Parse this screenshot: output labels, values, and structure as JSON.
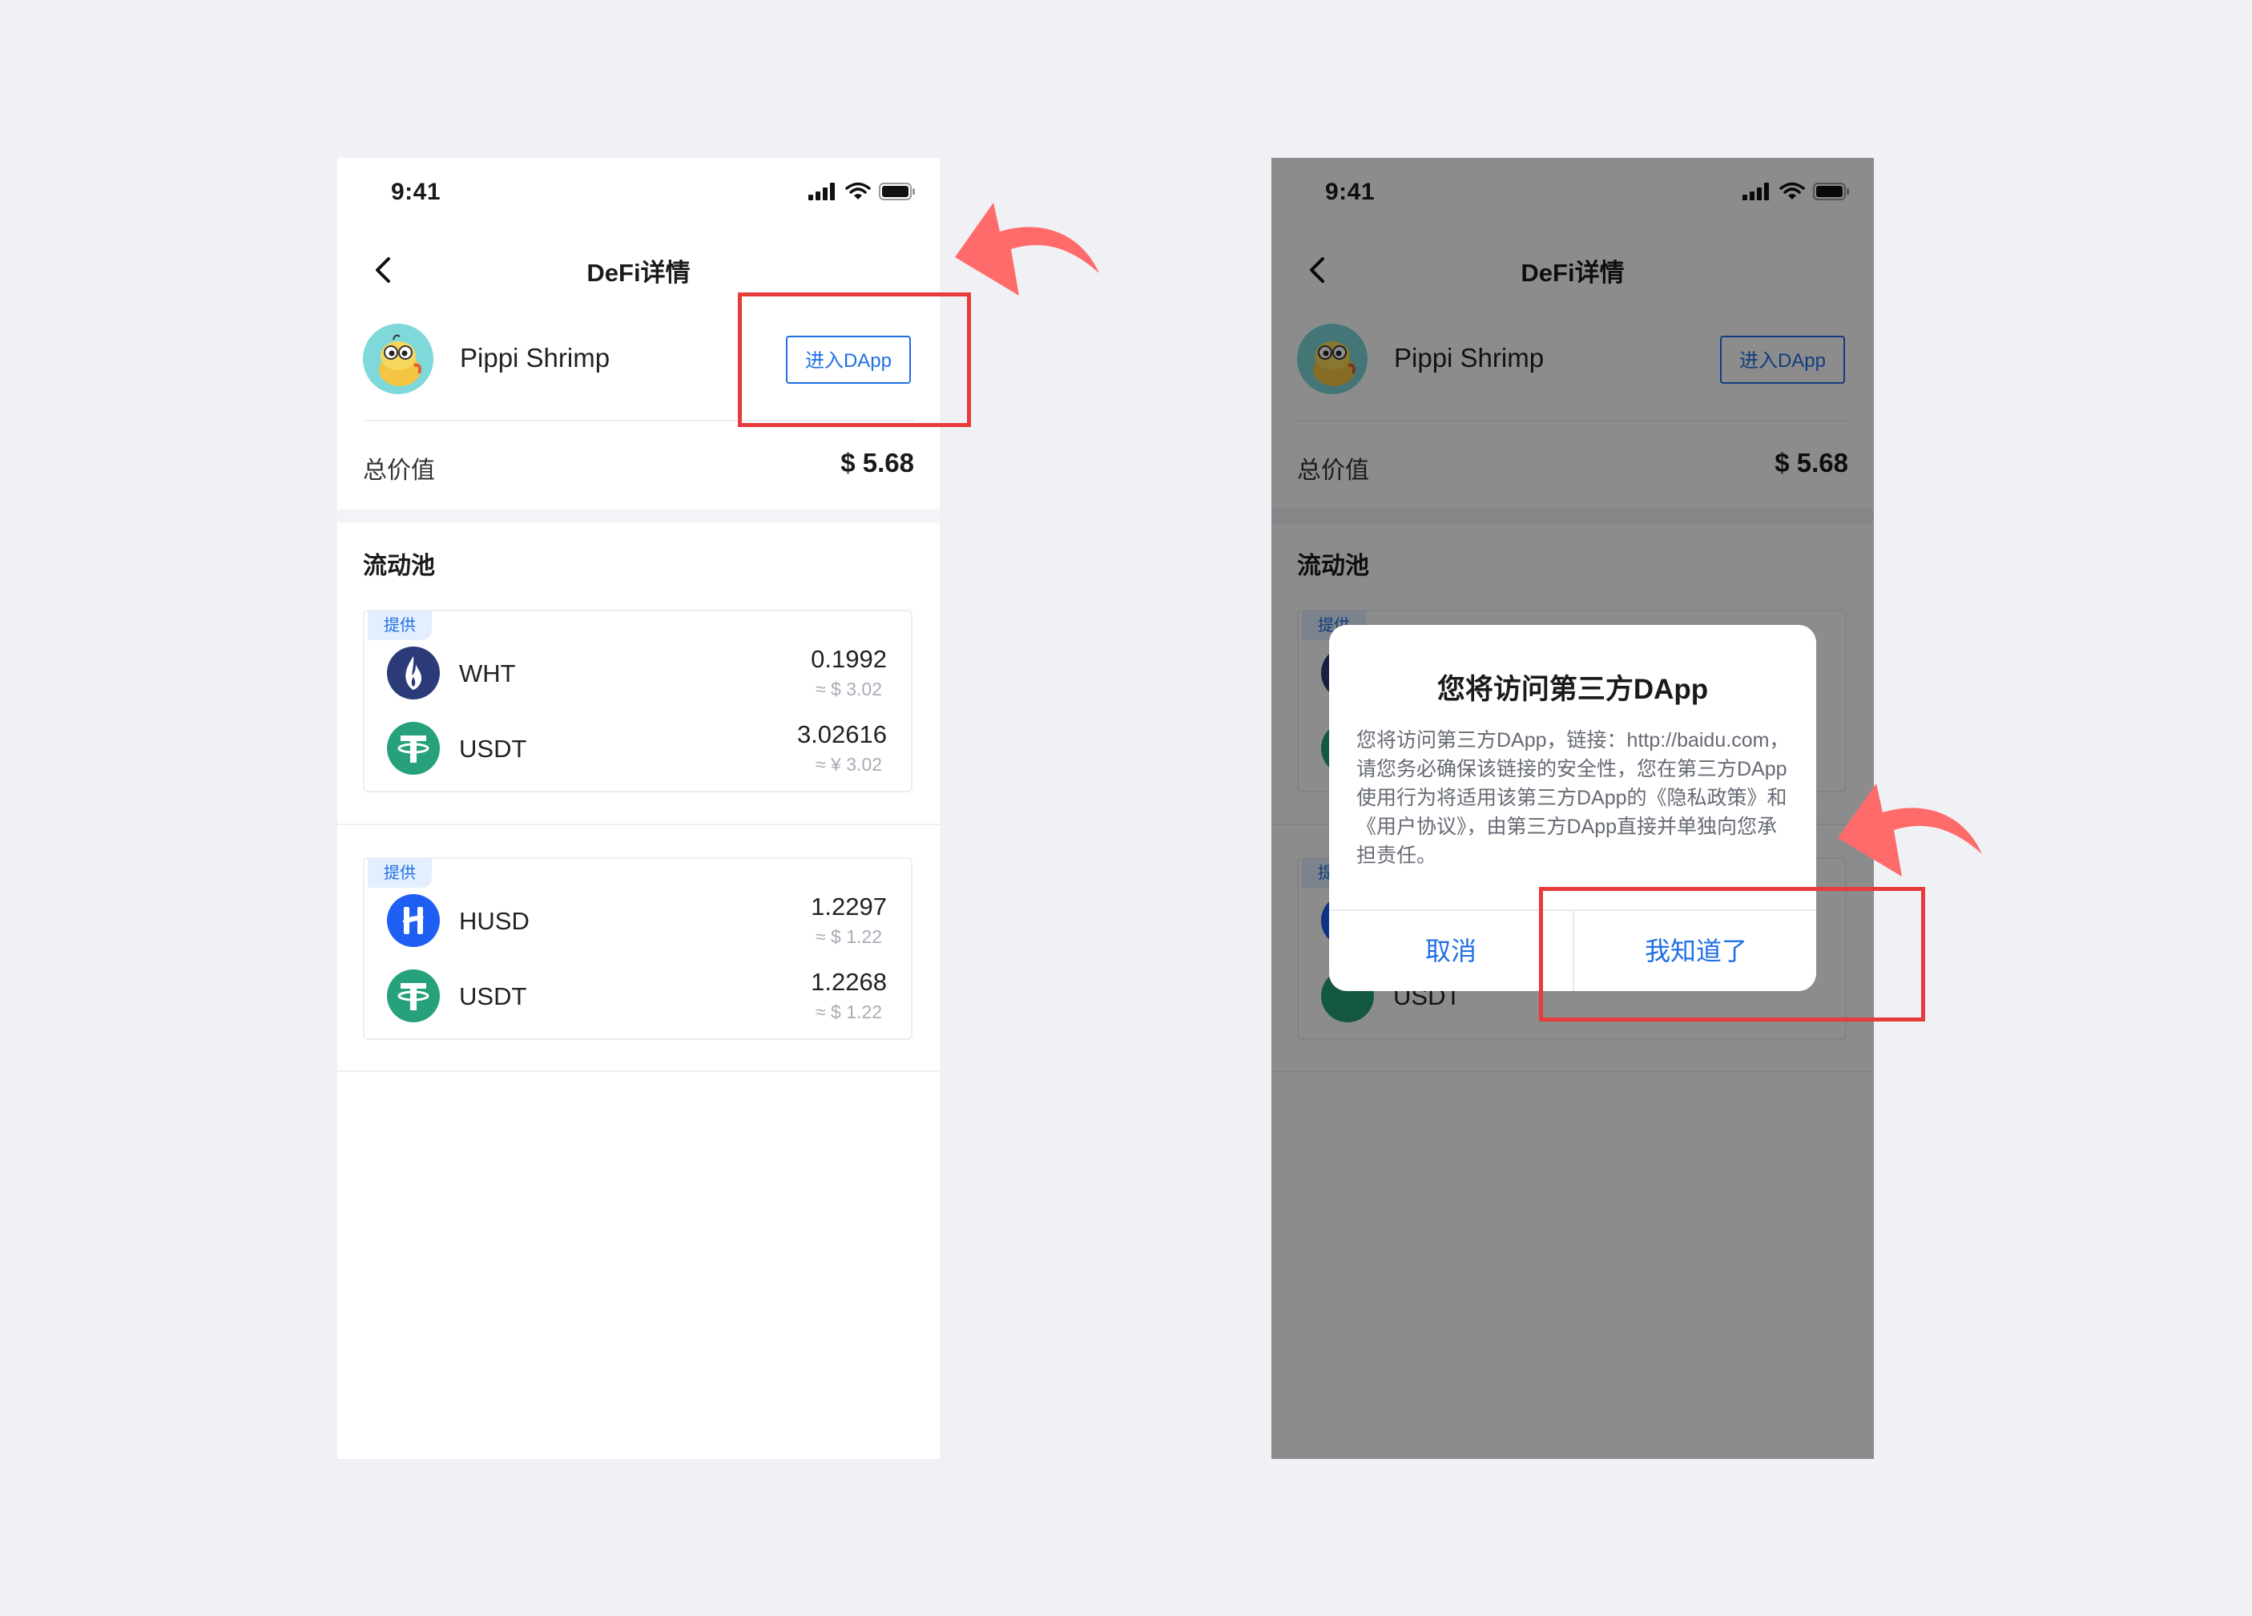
{
  "colors": {
    "accent": "#1f6fe5",
    "annotation_red": "#e83b3b",
    "arrow_coral": "#ff6b6b",
    "tether_green": "#26a17b",
    "husd_blue": "#1e5ef3",
    "wht_navy": "#2b3a78"
  },
  "left": {
    "status": {
      "time": "9:41"
    },
    "nav": {
      "title": "DeFi详情"
    },
    "dapp": {
      "name": "Pippi Shrimp",
      "enter_label": "进入DApp"
    },
    "total": {
      "label": "总价值",
      "value": "$ 5.68"
    },
    "pool_section": {
      "title": "流动池"
    },
    "pools": [
      {
        "tag": "提供",
        "tokens": [
          {
            "symbol": "WHT",
            "amount": "0.1992",
            "fiat": "≈ $ 3.02",
            "icon": "wht-icon"
          },
          {
            "symbol": "USDT",
            "amount": "3.02616",
            "fiat": "≈ ¥ 3.02",
            "icon": "usdt-icon"
          }
        ]
      },
      {
        "tag": "提供",
        "tokens": [
          {
            "symbol": "HUSD",
            "amount": "1.2297",
            "fiat": "≈ $ 1.22",
            "icon": "husd-icon"
          },
          {
            "symbol": "USDT",
            "amount": "1.2268",
            "fiat": "≈ $ 1.22",
            "icon": "usdt-icon"
          }
        ]
      }
    ]
  },
  "right": {
    "status": {
      "time": "9:41"
    },
    "nav": {
      "title": "DeFi详情"
    },
    "dapp": {
      "name": "Pippi Shrimp",
      "enter_label": "进入DApp"
    },
    "total": {
      "label": "总价值",
      "value": "$ 5.68"
    },
    "pool_section": {
      "title": "流动池"
    },
    "dialog": {
      "title": "您将访问第三方DApp",
      "body": "您将访问第三方DApp，链接：http://baidu.com，请您务必确保该链接的安全性，您在第三方DApp使用行为将适用该第三方DApp的《隐私政策》和《用户协议》，由第三方DApp直接并单独向您承担责任。",
      "cancel_label": "取消",
      "confirm_label": "我知道了"
    }
  }
}
